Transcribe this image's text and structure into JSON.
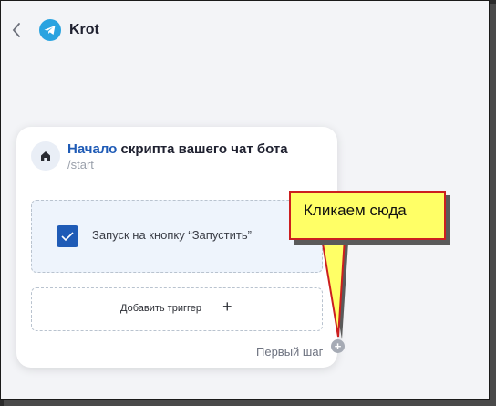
{
  "header": {
    "back_icon": "chevron-left-icon",
    "logo_icon": "telegram-icon",
    "title": "Krot"
  },
  "card": {
    "home_icon": "home-icon",
    "title_highlight": "Начало",
    "title_rest": " скрипта вашего чат бота",
    "subtitle": "/start",
    "trigger": {
      "checked": true,
      "label": "Запуск на кнопку “Запустить”"
    },
    "add_trigger_label": "Добавить триггер",
    "add_trigger_icon": "+",
    "step_label": "Первый шаг"
  },
  "step_add_icon": "+",
  "callout": {
    "text": "Кликаем сюда",
    "colors": {
      "fill": "#ffff66",
      "border": "#cc1f1f"
    }
  },
  "colors": {
    "accent": "#1f5bb6",
    "telegram": "#2aa3e0"
  }
}
